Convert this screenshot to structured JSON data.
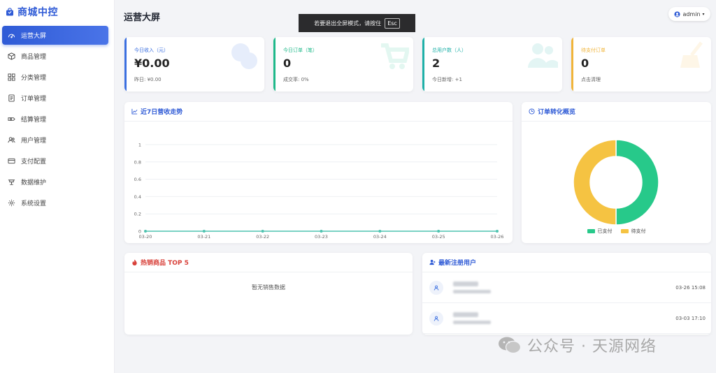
{
  "brand": {
    "title": "商城中控"
  },
  "sidebar": {
    "items": [
      {
        "label": "运营大屏",
        "icon": "dashboard-icon",
        "active": true
      },
      {
        "label": "商品管理",
        "icon": "box-icon"
      },
      {
        "label": "分类管理",
        "icon": "grid-icon"
      },
      {
        "label": "订单管理",
        "icon": "document-icon"
      },
      {
        "label": "结算管理",
        "icon": "settlement-icon"
      },
      {
        "label": "用户管理",
        "icon": "users-icon"
      },
      {
        "label": "支付配置",
        "icon": "card-icon"
      },
      {
        "label": "数据维护",
        "icon": "data-icon"
      },
      {
        "label": "系统设置",
        "icon": "gear-icon"
      }
    ]
  },
  "header": {
    "title": "运营大屏",
    "toast_text": "若要退出全屏模式，请按住",
    "toast_key": "Esc",
    "user": "admin"
  },
  "stats": [
    {
      "label": "今日收入（元）",
      "value": "¥0.00",
      "sub": "昨日: ¥0.00",
      "color": "#3b6fe0",
      "icon": "coins-icon"
    },
    {
      "label": "今日订单（笔）",
      "value": "0",
      "sub": "成交率: 0%",
      "color": "#1fb98a",
      "icon": "cart-icon"
    },
    {
      "label": "总用户数（人）",
      "value": "2",
      "sub": "今日新增: +1",
      "color": "#1fb0a8",
      "icon": "users-icon"
    },
    {
      "label": "待支付订单",
      "value": "0",
      "sub": "点击清理",
      "color": "#f0b43a",
      "icon": "broom-icon"
    }
  ],
  "revenue_panel": {
    "title": "近7日营收走势"
  },
  "conversion_panel": {
    "title": "订单转化概览"
  },
  "hot_panel": {
    "title": "热销商品 TOP 5",
    "empty": "暂无销售数据"
  },
  "users_panel": {
    "title": "最新注册用户",
    "rows": [
      {
        "time": "03-26 15:08"
      },
      {
        "time": "03-03 17:10"
      }
    ]
  },
  "watermark": {
    "text": "公众号 · 天源网络"
  },
  "chart_data": [
    {
      "type": "line",
      "title": "近7日营收走势",
      "x": [
        "03-20",
        "03-21",
        "03-22",
        "03-23",
        "03-24",
        "03-25",
        "03-26"
      ],
      "series": [
        {
          "values": [
            0,
            0,
            0,
            0,
            0,
            0,
            0
          ]
        }
      ],
      "yticks": [
        "0",
        "0.2",
        "0.4",
        "0.6",
        "0.8",
        "1"
      ],
      "ylim": [
        0,
        1
      ],
      "grid": true,
      "color": "#4fc3b0"
    },
    {
      "type": "pie",
      "title": "订单转化概览",
      "donut": true,
      "labels": [
        "已支付",
        "待支付"
      ],
      "values": [
        1,
        1
      ],
      "colors": [
        "#27c98a",
        "#f5c342"
      ],
      "legend": "bottom"
    }
  ]
}
